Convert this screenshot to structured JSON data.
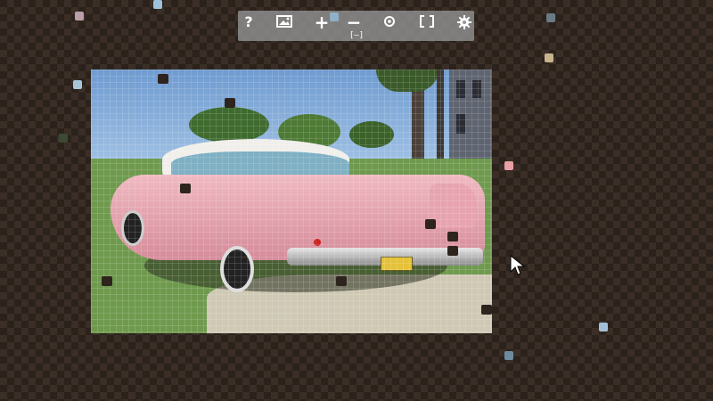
{
  "toolbar": {
    "help_label": "?",
    "zoom_in_label": "+",
    "zoom_out_label": "−",
    "fit_label": "[—]"
  },
  "puzzle": {
    "image_description_colors": {
      "sky": "#9fc3e8",
      "car": "#e7a3b0",
      "car_roof": "#f3f1ee",
      "grass": "#7fa25a",
      "ground": "#d8d2c0"
    }
  },
  "colors": {
    "background_dark": "#2b221c",
    "background_light": "#3a2e26",
    "toolbar_bg": "#969696",
    "hole": "#2e241e"
  }
}
